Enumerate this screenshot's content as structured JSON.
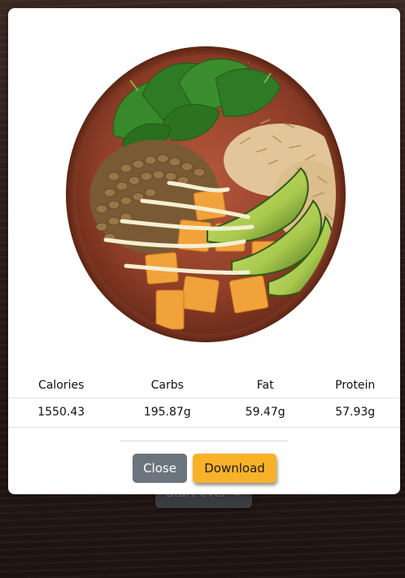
{
  "background": {
    "start_over_label": "Start over",
    "refresh_icon": "refresh-icon"
  },
  "modal": {
    "image_alt": "Lentil, spinach, rice and sweet potato bowl with avocado",
    "table": {
      "headers": [
        "Calories",
        "Carbs",
        "Fat",
        "Protein"
      ],
      "values": [
        "1550.43",
        "195.87g",
        "59.47g",
        "57.93g"
      ]
    },
    "close_label": "Close",
    "download_label": "Download"
  },
  "colors": {
    "close_button": "#6c757d",
    "download_button": "#f8b22a",
    "backdrop": "#2a1b17"
  }
}
